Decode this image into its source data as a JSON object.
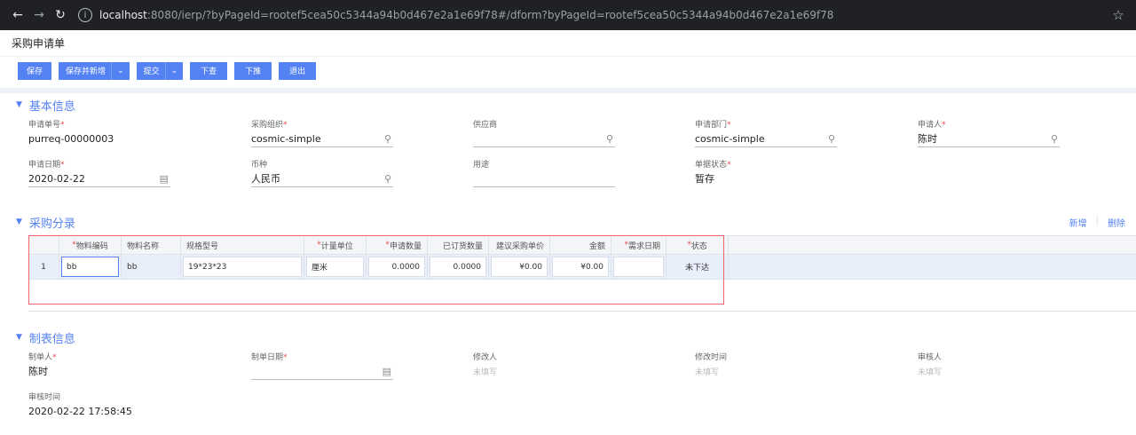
{
  "browser": {
    "url_host": "localhost",
    "url_rest": ":8080/ierp/?byPageId=rootef5cea50c5344a94b0d467e2a1e69f78#/dform?byPageId=rootef5cea50c5344a94b0d467e2a1e69f78"
  },
  "page": {
    "title": "采购申请单"
  },
  "toolbar": {
    "save": "保存",
    "save_and_new": "保存并新增",
    "submit": "提交",
    "lookup": "下查",
    "push": "下推",
    "exit": "退出"
  },
  "basic": {
    "title": "基本信息",
    "fields": [
      {
        "label": "申请单号",
        "required": "*",
        "value": "purreq-00000003"
      },
      {
        "label": "采购组织",
        "required": "*",
        "value": "cosmic-simple"
      },
      {
        "label": "供应商",
        "required": "",
        "value": ""
      },
      {
        "label": "申请部门",
        "required": "*",
        "value": "cosmic-simple"
      },
      {
        "label": "申请人",
        "required": "*",
        "value": "陈时"
      },
      {
        "label": "申请日期",
        "required": "*",
        "value": "2020-02-22"
      },
      {
        "label": "币种",
        "required": "",
        "value": "人民币"
      },
      {
        "label": "用途",
        "required": "",
        "value": ""
      },
      {
        "label": "单据状态",
        "required": "*",
        "value": "暂存"
      }
    ]
  },
  "entries": {
    "title": "采购分录",
    "add": "新增",
    "delete": "删除",
    "headers": [
      {
        "label": "",
        "required": ""
      },
      {
        "label": "物料编码",
        "required": "*"
      },
      {
        "label": "物料名称",
        "required": ""
      },
      {
        "label": "规格型号",
        "required": ""
      },
      {
        "label": "计量单位",
        "required": "*"
      },
      {
        "label": "申请数量",
        "required": "*"
      },
      {
        "label": "已订货数量",
        "required": ""
      },
      {
        "label": "建议采购单价",
        "required": ""
      },
      {
        "label": "金额",
        "required": ""
      },
      {
        "label": "需求日期",
        "required": "*"
      },
      {
        "label": "状态",
        "required": "*"
      }
    ],
    "rows": [
      {
        "seq": "1",
        "code": "bb",
        "name": "bb",
        "spec": "19*23*23",
        "unit": "厘米",
        "qty": "0.0000",
        "ordered": "0.0000",
        "price": "¥0.00",
        "amount": "¥0.00",
        "date": "",
        "status": "未下达"
      }
    ]
  },
  "audit": {
    "title": "制表信息",
    "fields": [
      {
        "label": "制单人",
        "required": "*",
        "value": "陈时"
      },
      {
        "label": "制单日期",
        "required": "*",
        "value": ""
      },
      {
        "label": "修改人",
        "required": "",
        "value": "未填写"
      },
      {
        "label": "修改时间",
        "required": "",
        "value": "未填写"
      },
      {
        "label": "审核人",
        "required": "",
        "value": "未填写"
      },
      {
        "label": "审核时间",
        "required": "",
        "value": "2020-02-22 17:58:45"
      }
    ]
  }
}
